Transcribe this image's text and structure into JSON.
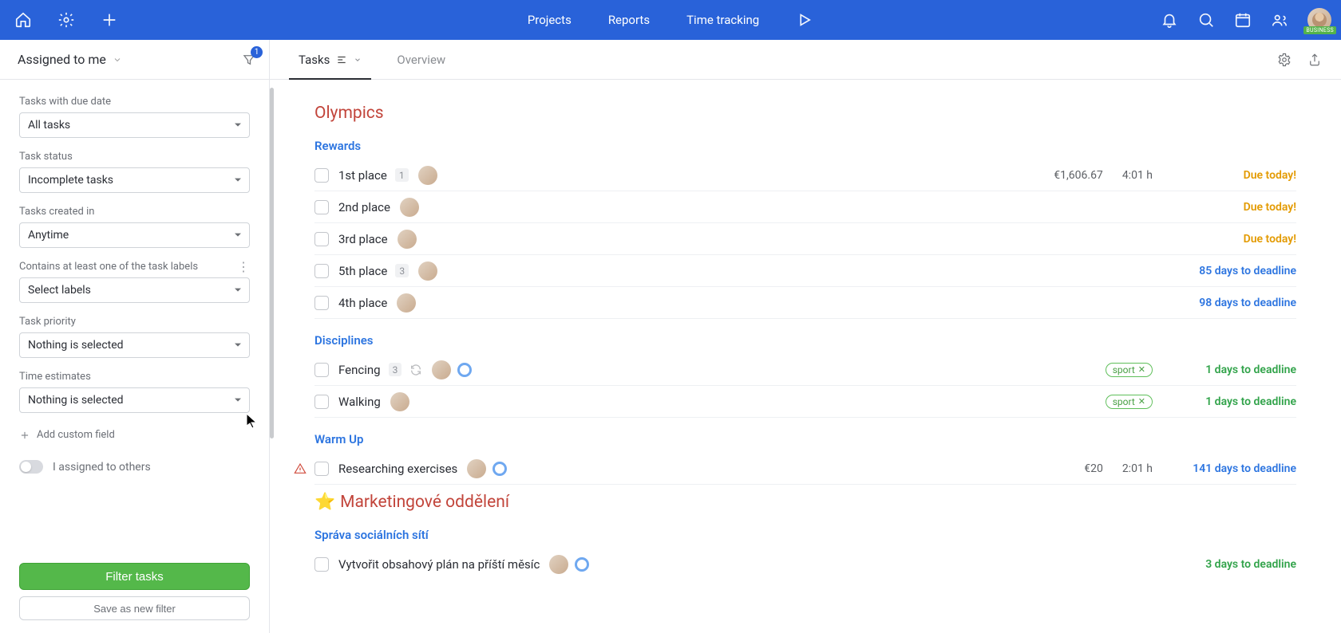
{
  "header": {
    "nav": [
      "Projects",
      "Reports",
      "Time tracking"
    ],
    "plan": "BUSINESS"
  },
  "sidebar": {
    "title": "Assigned to me",
    "funnel_badge": "1",
    "filters": {
      "due_label": "Tasks with due date",
      "due_value": "All tasks",
      "status_label": "Task status",
      "status_value": "Incomplete tasks",
      "created_label": "Tasks created in",
      "created_value": "Anytime",
      "labels_label": "Contains at least one of the task labels",
      "labels_value": "Select labels",
      "priority_label": "Task priority",
      "priority_value": "Nothing is selected",
      "estimates_label": "Time estimates",
      "estimates_value": "Nothing is selected",
      "add_custom": "Add custom field",
      "assigned_toggle": "I assigned to others"
    },
    "footer": {
      "filter_btn": "Filter tasks",
      "save_btn": "Save as new filter"
    }
  },
  "tabs": {
    "tasks": "Tasks",
    "overview": "Overview"
  },
  "content": {
    "projects": [
      {
        "title": "Olympics",
        "emoji": "",
        "lists": [
          {
            "name": "Rewards",
            "tasks": [
              {
                "name": "1st place",
                "badge": "1",
                "avatar": true,
                "money": "€1,606.67",
                "time": "4:01 h",
                "due": "Due today!",
                "due_type": "today"
              },
              {
                "name": "2nd place",
                "avatar": true,
                "due": "Due today!",
                "due_type": "today"
              },
              {
                "name": "3rd place",
                "avatar": true,
                "due": "Due today!",
                "due_type": "today"
              },
              {
                "name": "5th place",
                "badge": "3",
                "avatar": true,
                "due": "85 days to deadline",
                "due_type": "blue"
              },
              {
                "name": "4th place",
                "avatar": true,
                "due": "98 days to deadline",
                "due_type": "blue"
              }
            ]
          },
          {
            "name": "Disciplines",
            "tasks": [
              {
                "name": "Fencing",
                "badge": "3",
                "repeat": true,
                "avatar": true,
                "ring": true,
                "tag": "sport",
                "due": "1 days to deadline",
                "due_type": "green"
              },
              {
                "name": "Walking",
                "avatar": true,
                "tag": "sport",
                "due": "1 days to deadline",
                "due_type": "green"
              }
            ]
          },
          {
            "name": "Warm Up",
            "tasks": [
              {
                "name": "Researching exercises",
                "avatar": true,
                "ring": true,
                "warn": true,
                "money": "€20",
                "time": "2:01 h",
                "due": "141 days to deadline",
                "due_type": "blue"
              }
            ]
          }
        ]
      },
      {
        "title": "Marketingové oddělení",
        "emoji": "⭐",
        "lists": [
          {
            "name": "Správa sociálních sítí",
            "tasks": [
              {
                "name": "Vytvořit obsahový plán na příští měsíc",
                "avatar": true,
                "ring": true,
                "due": "3 days to deadline",
                "due_type": "green",
                "noborder": true
              }
            ]
          }
        ]
      }
    ]
  }
}
